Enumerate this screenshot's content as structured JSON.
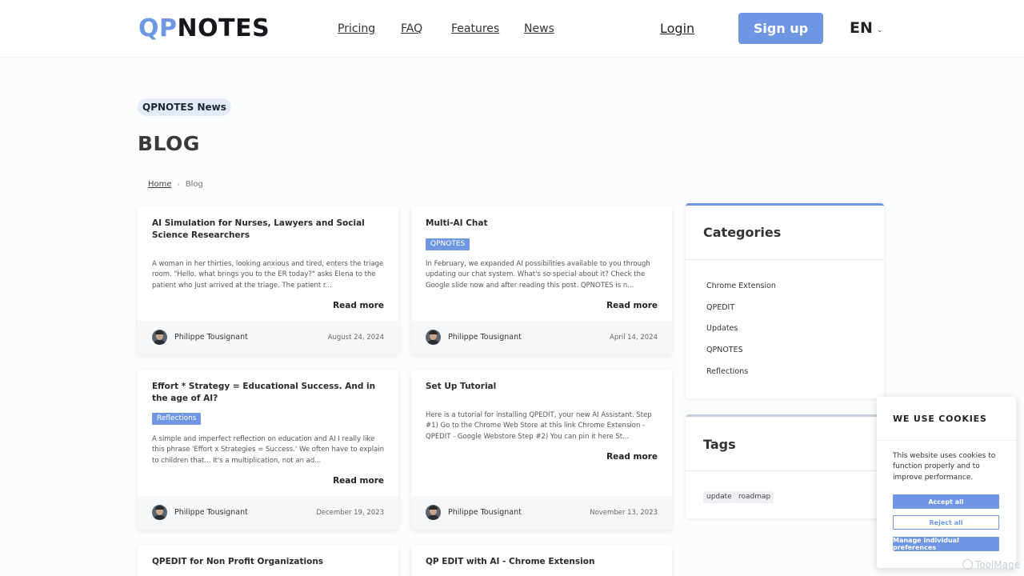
{
  "header": {
    "logo_qp": "QP",
    "logo_notes": "NOTES",
    "nav": [
      "Pricing",
      "FAQ",
      "Features",
      "News"
    ],
    "login": "Login",
    "signup": "Sign up",
    "language": "EN"
  },
  "hero": {
    "pill": "QPNOTES News",
    "title": "BLOG"
  },
  "breadcrumb": {
    "home": "Home",
    "current": "Blog"
  },
  "posts": [
    {
      "title": "AI Simulation for Nurses, Lawyers and Social Science Researchers",
      "tag": "",
      "excerpt": "A woman in her thirties, looking anxious and tired, enters the triage room. \"Hello, what brings you to the ER today?\" asks Elena to the patient who just arrived at the triage.  The patient r...",
      "read_more": "Read more",
      "author": "Philippe Tousignant",
      "date": "August 24, 2024"
    },
    {
      "title": "Multi-AI Chat",
      "tag": "QPNOTES",
      "excerpt": "In February, we expanded AI possibilities available to you through updating our chat system. What's so special about it? Check the Google slide now and after reading this post. QPNOTES is n...",
      "read_more": "Read more",
      "author": "Philippe Tousignant",
      "date": "April 14, 2024"
    },
    {
      "title": "Effort * Strategy = Educational Success. And in the age of AI?",
      "tag": "Reflections",
      "excerpt": "A simple and imperfect reflection on education and AI I really like this phrase 'Effort x Strategies = Success.' We often have to explain to children that... It's a multiplication, not an ad...",
      "read_more": "Read more",
      "author": "Philippe Tousignant",
      "date": "December 19, 2023"
    },
    {
      "title": "Set Up Tutorial",
      "tag": "",
      "excerpt": "Here is a tutorial for installing QPEDIT, your new AI Assistant. Step #1) Go to the Chrome Web Store at this link Chrome Extension - QPEDIT - Google Webstore Step #2) You can pin it here St...",
      "read_more": "Read more",
      "author": "Philippe Tousignant",
      "date": "November 13, 2023"
    },
    {
      "title": "QPEDIT for Non Profit Organizations"
    },
    {
      "title": "QP EDIT with AI - Chrome Extension"
    }
  ],
  "sidebar": {
    "categories_title": "Categories",
    "categories": [
      "Chrome Extension",
      "QPEDIT",
      "Updates",
      "QPNOTES",
      "Reflections"
    ],
    "tags_title": "Tags",
    "tags": [
      "update",
      "roadmap"
    ]
  },
  "cookie": {
    "title": "WE USE COOKIES",
    "text": "This website uses cookies to function properly and to improve performance.",
    "accept": "Accept all",
    "reject": "Reject all",
    "manage": "Manage individual preferences"
  },
  "watermark": "ToolMage",
  "colors": {
    "accent": "#6f96e2",
    "logo_accent": "#6d97e3"
  }
}
